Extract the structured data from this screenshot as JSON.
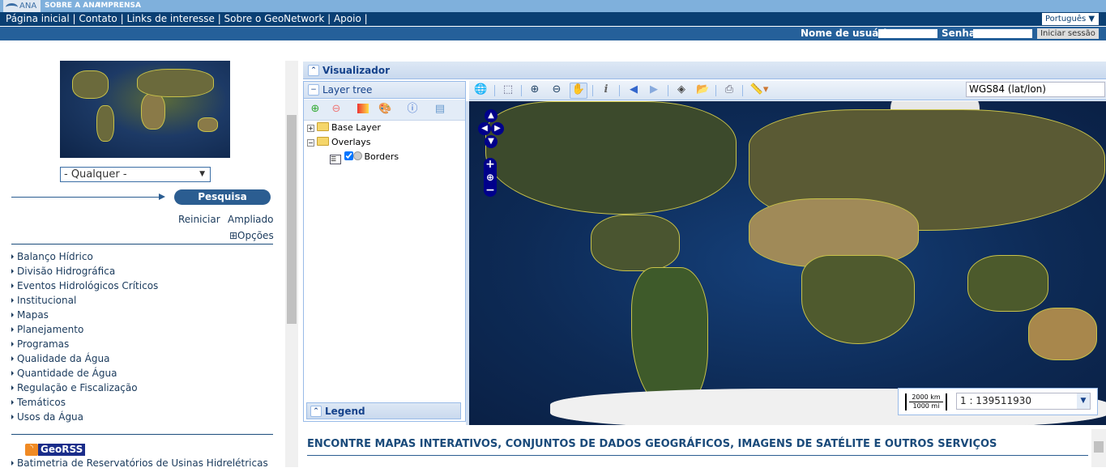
{
  "topbar": {
    "logo": "ANA",
    "links": [
      "SOBRE A ANA",
      "IMPRENSA"
    ]
  },
  "nav": {
    "items": [
      "Página inicial",
      "Contato",
      "Links de interesse",
      "Sobre o GeoNetwork",
      "Apoio"
    ],
    "language": "Português ▼"
  },
  "login": {
    "username_label": "Nome de usuário",
    "password_label": "Senha",
    "submit": "Iniciar sessão"
  },
  "search": {
    "region_select": "- Qualquer -",
    "search_button": "Pesquisa",
    "reset": "Reiniciar",
    "advanced": "Ampliado",
    "options": "⊞Opções"
  },
  "categories": [
    "Balanço Hídrico",
    "Divisão Hidrográfica",
    "Eventos Hidrológicos Críticos",
    "Institucional",
    "Mapas",
    "Planejamento",
    "Programas",
    "Qualidade da Água",
    "Quantidade de Água",
    "Regulação e Fiscalização",
    "Temáticos",
    "Usos da Água"
  ],
  "georss": {
    "label": "GeoRSS",
    "items": [
      "Batimetria de Reservatórios de Usinas Hidrelétricas"
    ]
  },
  "viewer": {
    "title": "Visualizador",
    "layer_tree": "Layer tree",
    "base_layer": "Base Layer",
    "overlays": "Overlays",
    "borders": "Borders",
    "legend": "Legend",
    "projection": "WGS84 (lat/lon)",
    "scale": "1 : 139511930",
    "scale_km": "2000 km",
    "scale_mi": "1000 mi"
  },
  "banner": "ENCONTRE MAPAS INTERATIVOS, CONJUNTOS DE DADOS GEOGRÁFICOS, IMAGENS DE SATÉLITE E OUTROS SERVIÇOS",
  "colors": {
    "nav": "#0a3f73",
    "login_bar": "#25609a",
    "top_bar": "#7fb0dc",
    "panel_header": "#15428b"
  }
}
